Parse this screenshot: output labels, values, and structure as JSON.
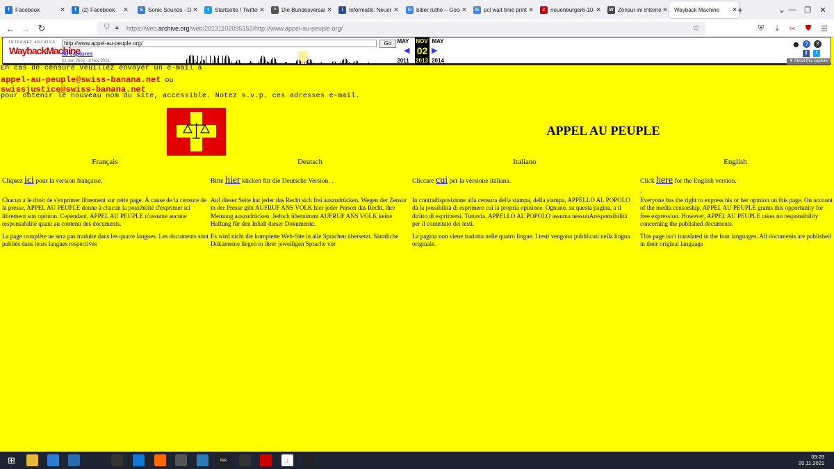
{
  "tabs": [
    {
      "title": "Facebook",
      "icon": "facebook-icon",
      "color": "#1877f2",
      "glyph": "f"
    },
    {
      "title": "(2) Facebook",
      "icon": "facebook-icon",
      "color": "#1877f2",
      "glyph": "f"
    },
    {
      "title": "Sonic Sounds - Da",
      "icon": "sonic-icon",
      "color": "#3a7bd5",
      "glyph": "S"
    },
    {
      "title": "Startseite / Twitter",
      "icon": "twitter-icon",
      "color": "#1d9bf0",
      "glyph": "t"
    },
    {
      "title": "Die Bundesversam",
      "icon": "bundes-icon",
      "color": "#555555",
      "glyph": "^"
    },
    {
      "title": "Informatik: Neuer",
      "icon": "informatik-icon",
      "color": "#2b4aa0",
      "glyph": "i"
    },
    {
      "title": "biber ruthe – Goog",
      "icon": "google-icon",
      "color": "#4285f4",
      "glyph": "G"
    },
    {
      "title": "pcl wait time print",
      "icon": "google-icon",
      "color": "#4285f4",
      "glyph": "G"
    },
    {
      "title": "neuenburger6-10-",
      "icon": "z-icon",
      "color": "#d00000",
      "glyph": "Z"
    },
    {
      "title": "Zensur im Internet",
      "icon": "wikipedia-icon",
      "color": "#444444",
      "glyph": "W"
    },
    {
      "title": "Wayback Machine",
      "icon": "wayback-icon",
      "color": "#ffffff",
      "glyph": ""
    }
  ],
  "browser": {
    "url_prefix": "https://web.",
    "url_domain": "archive.org",
    "url_rest": "/web/20131102095152/http://www.appel-au-peuple.org/"
  },
  "wayback": {
    "logo_top": "INTERNET ARCHIVE",
    "logo": "WaybackMachine",
    "url_input": "http://www.appel-au-peuple.org/",
    "go": "Go",
    "captures": "88 captures",
    "range": "21 Jan 2002 - 8 Nov 2021",
    "month_prev": "MAY",
    "month_cur": "NOV",
    "month_next": "MAY",
    "day": "02",
    "year_prev": "2011",
    "year_cur": "2013",
    "year_next": "2014",
    "about": "▼ About this capture"
  },
  "page": {
    "censorship_line": "En cas de censure veuillez envoyer un e-mail à",
    "email1": "appel-au-peuple@swiss-banana.net",
    "ou": " ou",
    "email2": "swissjustice@swiss-banana.net",
    "notice": "pour obtenir le nouveau nom du site, accessible. Notez s.v.p. ces adresses e-mail.",
    "title": "APPEL AU PEUPLE",
    "columns": [
      {
        "lang": "Français",
        "pre": "Cliquez ",
        "link": "ici",
        "post": " pour la version française.",
        "p1": "Chacun a le droit de s'exprimer librement sur cette page. À cause de la censure de la presse,  APPEL AU PEUPLE donne à chacun la possibilité d'exprimer ici librement son opinion. Cependant, APPEL AU PEUPLE n'assume aucune responsabilité quant au contenu des documents.",
        "p2": "La page complète ne sera pas traduite dans les quatre langues. Les documents sont publiés dans leurs langues respectives"
      },
      {
        "lang": "Deutsch",
        "pre": "Bitte ",
        "link": "hier",
        "post": " klicken für die Deutsche Version. .",
        "p1": "Auf dieser Seite hat jeder das Recht sich frei auszudrücken. Wegen der Zensur in der Presse gibt AUFRUF ANS VOLK hier jeder Person das Recht, ihre Meinung auszudrücken. Jedoch übernimmt AUFRUF ANS VOLK keine Haftung für den Inhalt dieser Dokumente.",
        "p2": "Es wird nicht die komplette Web-Site in alle Sprachen übersetzt. Sämtliche Dokumente liegen in ihrer jeweiligen Sprache vor"
      },
      {
        "lang": "Italiano",
        "pre": "Cliccare ",
        "link": "cui",
        "post": " per la versione italiana.",
        "p1": "In contradisposizione  alla censura della stampa, della stampa, APPELLO AL POPOLO dà la possibilità di esprimere cui la propria opinione. Ognuno, su questa pagina, a il diritto di esprimersi. Tuttavia, APPELLO AL POPOLO assuma nessunAresponsibilità per il contenuto dei testi.",
        "p2": "La pagina non viene tradotta nelle quatro lingue. I testi vengono pubblicati nella  lingua originale."
      },
      {
        "lang": "English",
        "pre": "Click ",
        "link": "here",
        "post": " for the English version.",
        "extra": ".",
        "p1": "Everyone has the right to express his or her opinion on this page. On account of the media censorship, APPEL AU PEUPLE grants this opportunity for free expression. However, APPEL AU PEUPLE takes no responsibility concerning the published documents.",
        "p2": "This page isn't translated in the four languages. All documents are published in their original language"
      }
    ]
  },
  "taskbar": {
    "time": "09:29",
    "date": "20.11.2021",
    "live_label": "live",
    "apps": [
      "windows-icon",
      "file-explorer-icon",
      "store-icon",
      "mail-icon",
      "pen-icon",
      "terminal-app-icon",
      "edge-icon",
      "firefox-icon",
      "screenshot-icon",
      "photos-icon",
      "live-icon",
      "obs-icon",
      "news-icon",
      "tiktok-icon",
      "cmd-icon"
    ]
  }
}
